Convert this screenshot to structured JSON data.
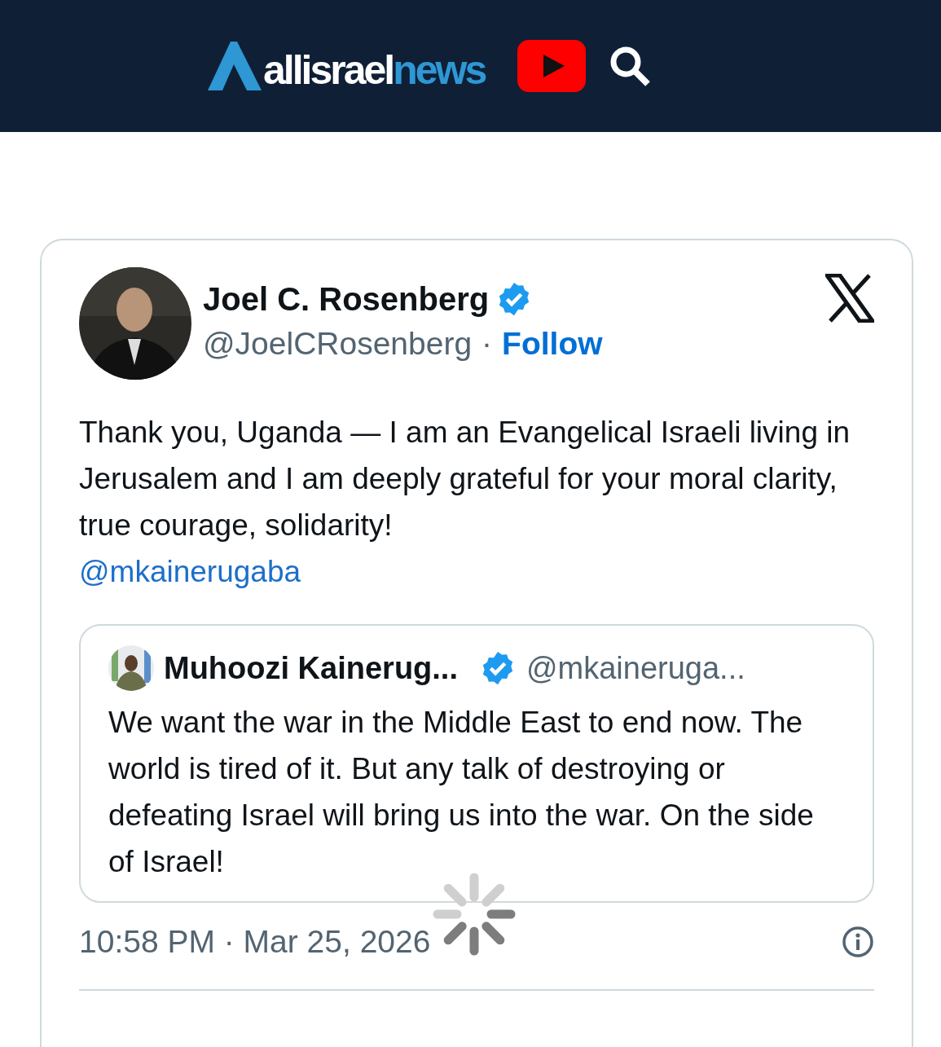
{
  "header": {
    "brand_text": "allisrael",
    "brand_accent": "news"
  },
  "tweet": {
    "author": {
      "name": "Joel C. Rosenberg",
      "verified": true,
      "handle": "@JoelCRosenberg",
      "separator": "·",
      "follow": "Follow"
    },
    "text": "Thank you, Uganda — I am an Evangelical Israeli living in Jerusalem and I am deeply grateful for your moral clarity, true courage, solidarity!",
    "mention": "@mkainerugaba",
    "quoted": {
      "name": "Muhoozi Kainerug...",
      "verified": true,
      "handle": "@mkaineruga...",
      "text": "We want the war in the Middle East to end now. The world is tired of it. But any talk of destroying or defeating Israel will bring us into the war. On the side of Israel!"
    },
    "timestamp": "10:58 PM · Mar 25, 2026",
    "loading": true
  }
}
